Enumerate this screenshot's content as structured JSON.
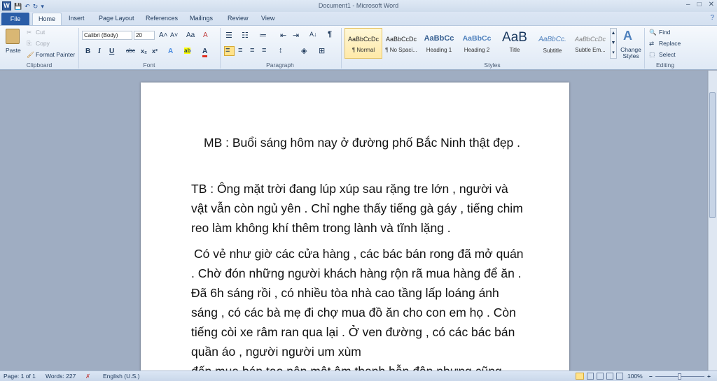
{
  "window": {
    "title": "Document1 - Microsoft Word",
    "logo": "W",
    "minimize": "–",
    "maximize": "□",
    "close": "✕",
    "help": "?",
    "ribbon_min": "▲"
  },
  "qat": {
    "save": "💾",
    "undo": "↶",
    "redo": "↻",
    "customize": "▾"
  },
  "tabs": {
    "file": "File",
    "home": "Home",
    "insert": "Insert",
    "page_layout": "Page Layout",
    "references": "References",
    "mailings": "Mailings",
    "review": "Review",
    "view": "View"
  },
  "clipboard": {
    "paste": "Paste",
    "cut": "Cut",
    "copy": "Copy",
    "format_painter": "Format Painter",
    "group": "Clipboard"
  },
  "font": {
    "name": "Calibri (Body)",
    "size": "20",
    "group": "Font",
    "bold": "B",
    "italic": "I",
    "underline": "U",
    "strike": "abc",
    "subscript": "x₂",
    "superscript": "x²",
    "grow": "A˄",
    "shrink": "A˅",
    "case": "Aa",
    "clear": "A",
    "effects": "A",
    "highlight": "ab",
    "color": "A"
  },
  "paragraph": {
    "group": "Paragraph",
    "show_marks": "¶",
    "sort": "A↓"
  },
  "styles": {
    "group": "Styles",
    "items": [
      {
        "sample": "AaBbCcDc",
        "name": "¶ Normal"
      },
      {
        "sample": "AaBbCcDc",
        "name": "¶ No Spaci..."
      },
      {
        "sample": "AaBbCc",
        "name": "Heading 1"
      },
      {
        "sample": "AaBbCc",
        "name": "Heading 2"
      },
      {
        "sample": "AaB",
        "name": "Title"
      },
      {
        "sample": "AaBbCc.",
        "name": "Subtitle"
      },
      {
        "sample": "AaBbCcDc",
        "name": "Subtle Em..."
      }
    ],
    "change_styles": "Change Styles"
  },
  "editing": {
    "group": "Editing",
    "find": "Find",
    "replace": "Replace",
    "select": "Select"
  },
  "colors": {
    "accent": "#2b579a",
    "file_tab": "#2a5da8"
  },
  "document": {
    "paragraphs": [
      "MB : Buổi sáng hôm nay ở đường phố Bắc Ninh thật đẹp .",
      "TB : Ông mặt trời đang lúp xúp sau rặng tre lớn , người và vật vẫn còn ngủ yên . Chỉ nghe thấy tiếng gà gáy , tiếng chim reo làm không khí thêm trong lành và tĩnh lặng .",
      "Có vẻ như giờ các cửa hàng , các bác bán rong đã mở quán . Chờ đón những người khách hàng rộn rã mua hàng để ăn . Đã 6h sáng rồi , có nhiều tòa nhà cao tầng lấp loáng ánh sáng , có các bà mẹ đi chợ mua đồ ăn cho con em họ . Còn tiếng còi xe râm ran qua lại . Ở ven đường , có các bác bán quần áo , người người um xùm",
      "đến mua bán tạo nên một âm thanh hỗn độn nhưng cũng"
    ]
  },
  "status": {
    "page": "Page: 1 of 1",
    "words": "Words: 227",
    "language": "English (U.S.)",
    "zoom": "100%",
    "zoom_out": "–",
    "zoom_in": "+"
  }
}
